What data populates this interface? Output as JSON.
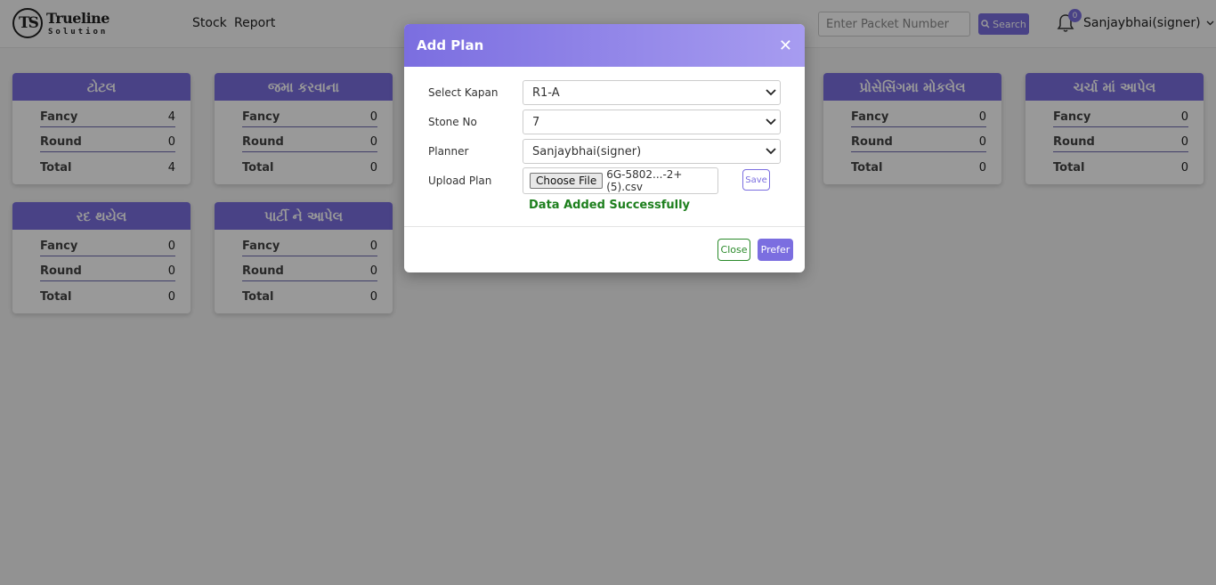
{
  "navbar": {
    "logo_mark": "TS",
    "logo_line1": "Trueline",
    "logo_line2": "Solution",
    "links": [
      "Stock",
      "Report"
    ],
    "search": {
      "placeholder": "Enter Packet Number",
      "button_label": "Search"
    },
    "notification_count": "0",
    "user": "Sanjaybhai(signer)"
  },
  "cards": [
    {
      "title": "ટોટલ",
      "rows": [
        {
          "label": "Fancy",
          "value": "4"
        },
        {
          "label": "Round",
          "value": "0"
        },
        {
          "label": "Total",
          "value": "4"
        }
      ]
    },
    {
      "title": "જમા કરવાના",
      "rows": [
        {
          "label": "Fancy",
          "value": "0"
        },
        {
          "label": "Round",
          "value": "0"
        },
        {
          "label": "Total",
          "value": "0"
        }
      ]
    },
    {
      "title": "પ્રોસેસિંગમા મોકલેલ",
      "rows": [
        {
          "label": "Fancy",
          "value": "0"
        },
        {
          "label": "Round",
          "value": "0"
        },
        {
          "label": "Total",
          "value": "0"
        }
      ]
    },
    {
      "title": "ચર્ચા માં આપેલ",
      "rows": [
        {
          "label": "Fancy",
          "value": "0"
        },
        {
          "label": "Round",
          "value": "0"
        },
        {
          "label": "Total",
          "value": "0"
        }
      ]
    },
    {
      "title": "રદ થયેલ",
      "rows": [
        {
          "label": "Fancy",
          "value": "0"
        },
        {
          "label": "Round",
          "value": "0"
        },
        {
          "label": "Total",
          "value": "0"
        }
      ]
    },
    {
      "title": "પાર્ટી ને આપેલ",
      "rows": [
        {
          "label": "Fancy",
          "value": "0"
        },
        {
          "label": "Round",
          "value": "0"
        },
        {
          "label": "Total",
          "value": "0"
        }
      ]
    }
  ],
  "modal": {
    "title": "Add Plan",
    "fields": {
      "kapan": {
        "label": "Select Kapan",
        "value": "R1-A"
      },
      "stone": {
        "label": "Stone No",
        "value": "7"
      },
      "planner": {
        "label": "Planner",
        "value": "Sanjaybhai(signer)"
      },
      "upload": {
        "label": "Upload Plan",
        "button": "Choose File",
        "file_name": "6G-5802...-2+ (5).csv"
      }
    },
    "save_label": "Save",
    "success_message": "Data Added Successfully",
    "close_label": "Close",
    "prefer_label": "Prefer"
  },
  "colors": {
    "accent": "#7b6ee0",
    "success": "#1d7f1d"
  }
}
